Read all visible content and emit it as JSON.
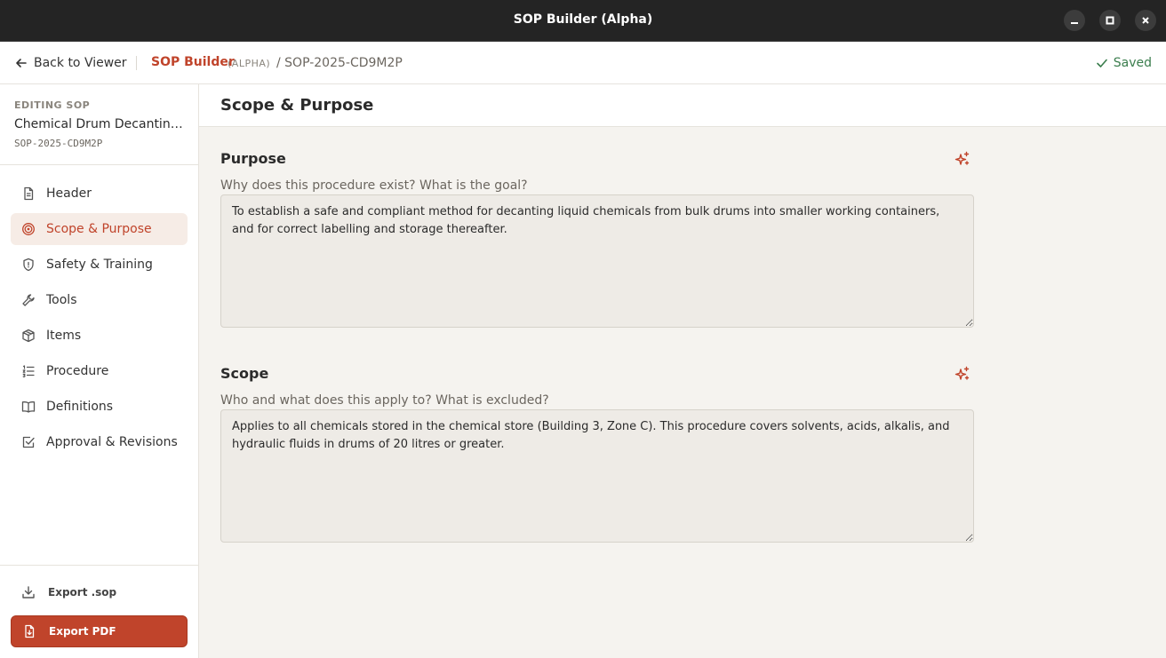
{
  "window": {
    "title": "SOP Builder (Alpha)"
  },
  "appbar": {
    "back_label": "Back to Viewer",
    "brand": "SOP Builder",
    "alpha_tag": "(ALPHA)",
    "crumb": "/ SOP-2025-CD9M2P",
    "saved_label": "Saved"
  },
  "sidebar": {
    "editing_label": "EDITING SOP",
    "doc_title": "Chemical Drum Decanting a...",
    "doc_id": "SOP-2025-CD9M2P",
    "items": [
      {
        "label": "Header",
        "icon": "document-icon"
      },
      {
        "label": "Scope & Purpose",
        "icon": "target-icon",
        "active": true
      },
      {
        "label": "Safety & Training",
        "icon": "shield-icon"
      },
      {
        "label": "Tools",
        "icon": "wrench-icon"
      },
      {
        "label": "Items",
        "icon": "box-icon"
      },
      {
        "label": "Procedure",
        "icon": "list-ordered-icon"
      },
      {
        "label": "Definitions",
        "icon": "book-icon"
      },
      {
        "label": "Approval & Revisions",
        "icon": "checkbox-icon"
      }
    ],
    "export_sop": "Export .sop",
    "export_pdf": "Export PDF"
  },
  "main": {
    "title": "Scope & Purpose",
    "purpose": {
      "title": "Purpose",
      "hint": "Why does this procedure exist? What is the goal?",
      "value": "To establish a safe and compliant method for decanting liquid chemicals from bulk drums into smaller working containers, and for correct labelling and storage thereafter."
    },
    "scope": {
      "title": "Scope",
      "hint": "Who and what does this apply to? What is excluded?",
      "value": "Applies to all chemicals stored in the chemical store (Building 3, Zone C). This procedure covers solvents, acids, alkalis, and hydraulic fluids in drums of 20 litres or greater."
    }
  },
  "colors": {
    "accent": "#c0442b",
    "saved": "#3a7d4d",
    "titlebar": "#242424"
  }
}
